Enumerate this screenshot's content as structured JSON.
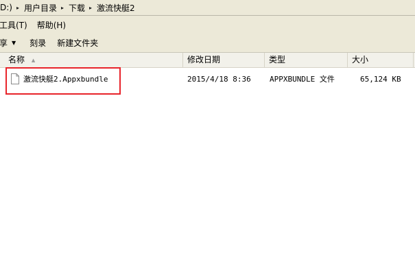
{
  "address": {
    "crumbs": [
      "D:)",
      "用户目录",
      "下载",
      "激流快艇2"
    ],
    "separator": "▸"
  },
  "menu": {
    "items": [
      "工具(T)",
      "帮助(H)"
    ]
  },
  "toolbar": {
    "share_label": "享",
    "burn_label": "刻录",
    "new_folder_label": "新建文件夹"
  },
  "columns": {
    "name": "名称",
    "date": "修改日期",
    "type": "类型",
    "size": "大小"
  },
  "files": [
    {
      "name": "激流快艇2.Appxbundle",
      "date": "2015/4/18 8:36",
      "type": "APPXBUNDLE 文件",
      "size": "65,124 KB"
    }
  ],
  "colors": {
    "highlight": "#e8232a",
    "chrome": "#ece9d8"
  }
}
